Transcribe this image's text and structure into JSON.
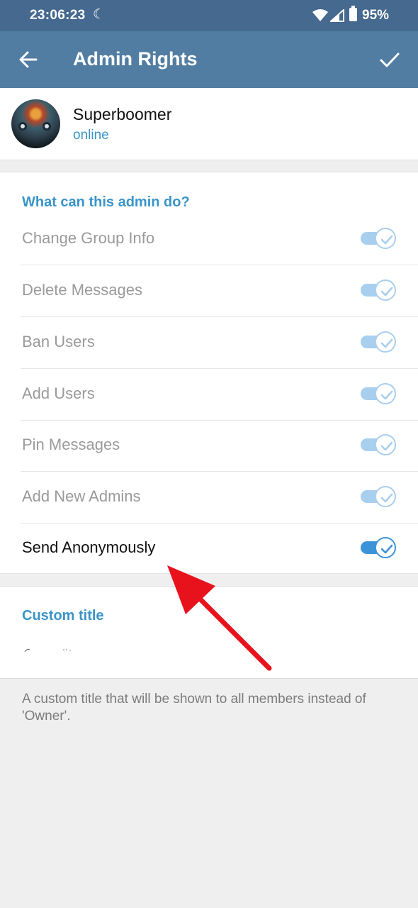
{
  "status_bar": {
    "time": "23:06:23",
    "battery_percent": "95%",
    "icons": [
      "do-not-disturb-moon-icon",
      "wifi-icon",
      "cell-signal-icon",
      "battery-icon"
    ]
  },
  "app_bar": {
    "title": "Admin Rights",
    "back_icon": "arrow-left-icon",
    "confirm_icon": "checkmark-icon",
    "color": "#527da3"
  },
  "profile": {
    "name": "Superboomer",
    "status": "online"
  },
  "permissions": {
    "heading": "What can this admin do?",
    "items": [
      {
        "label": "Change Group Info",
        "enabled": true,
        "editable": false
      },
      {
        "label": "Delete Messages",
        "enabled": true,
        "editable": false
      },
      {
        "label": "Ban Users",
        "enabled": true,
        "editable": false
      },
      {
        "label": "Add Users",
        "enabled": true,
        "editable": false
      },
      {
        "label": "Pin Messages",
        "enabled": true,
        "editable": false
      },
      {
        "label": "Add New Admins",
        "enabled": true,
        "editable": false
      },
      {
        "label": "Send Anonymously",
        "enabled": true,
        "editable": true
      }
    ]
  },
  "custom_title": {
    "heading": "Custom title",
    "value": "",
    "help_text": "A custom title that will be shown to all members instead of 'Owner'."
  },
  "annotation": {
    "arrow_color": "#e8121c",
    "points_to": "Send Anonymously"
  },
  "colors": {
    "accent": "#3a95c8",
    "toggle_on": "#3d93d8",
    "toggle_disabled": "#a9cfef"
  }
}
